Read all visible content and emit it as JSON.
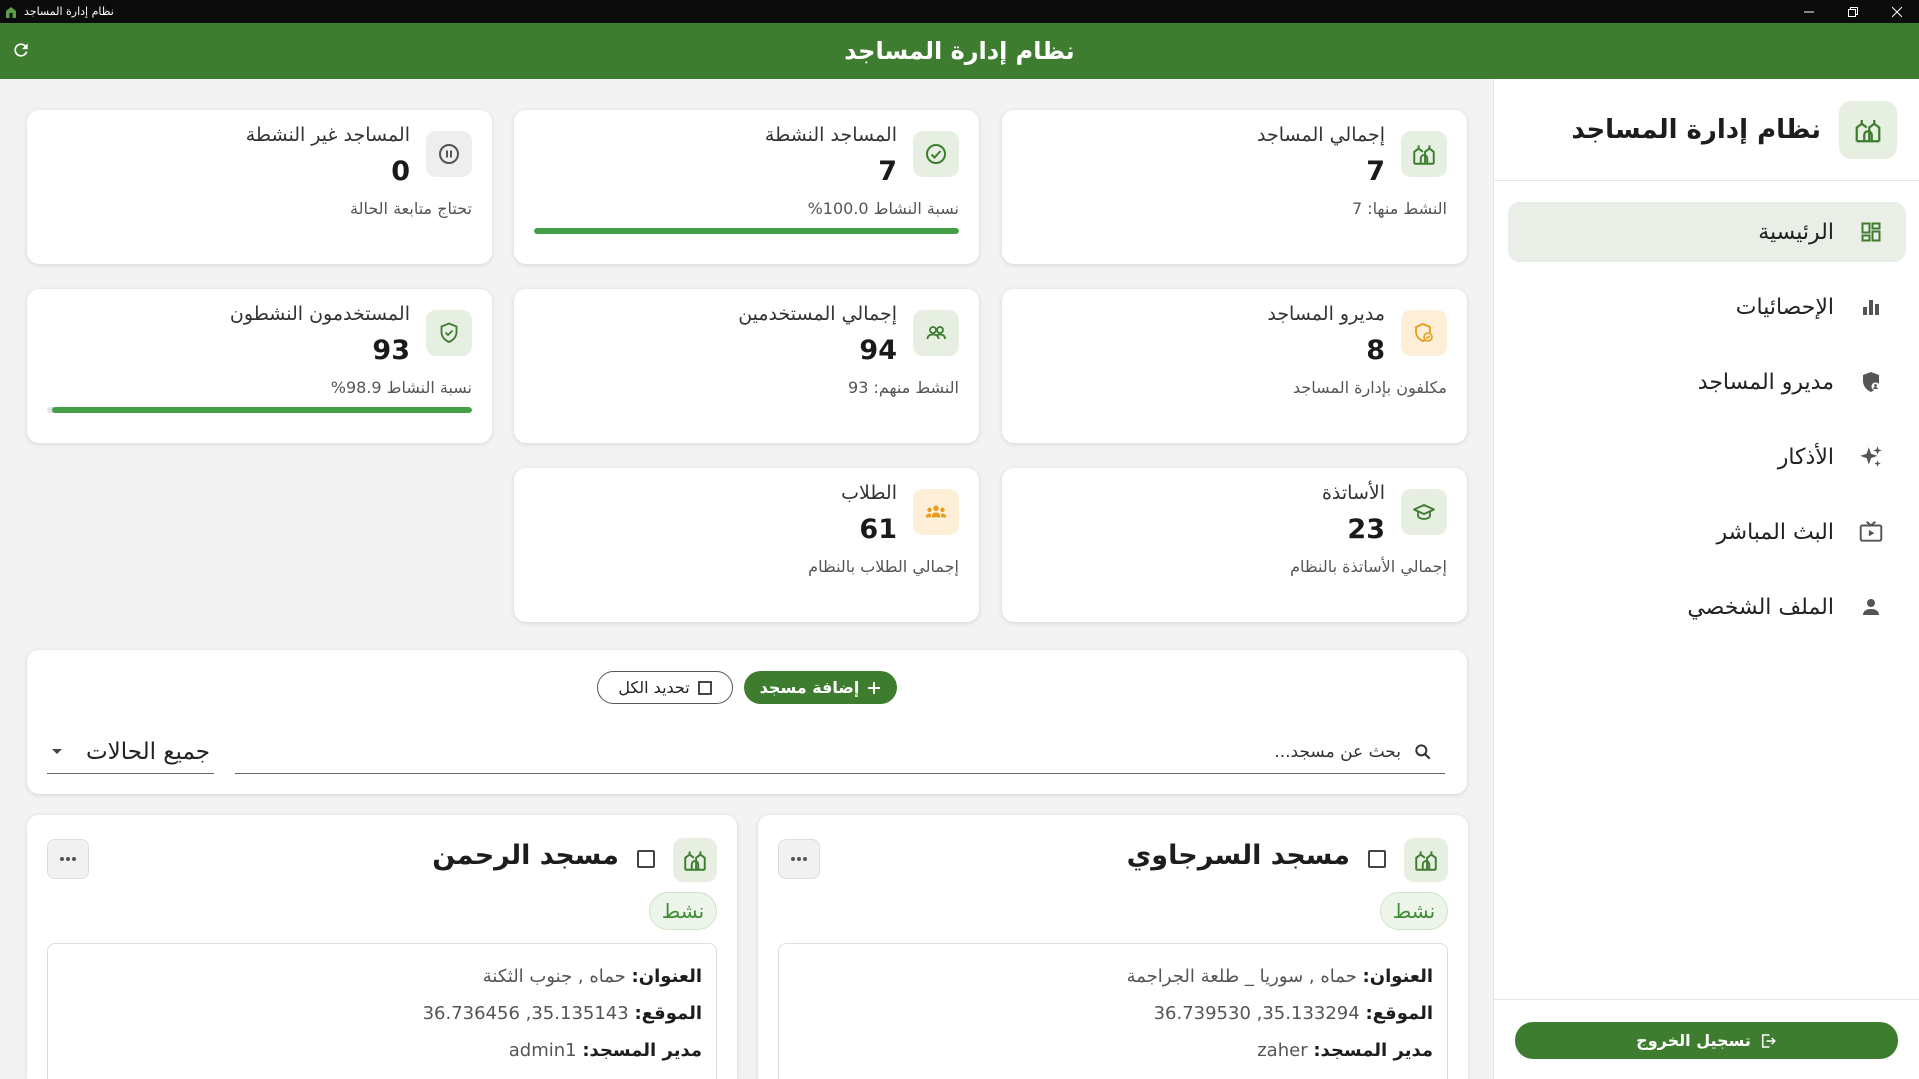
{
  "window": {
    "title": "نظام إدارة المساجد"
  },
  "appbar": {
    "title": "نظام إدارة المساجد"
  },
  "sidebar": {
    "brand": "نظام إدارة المساجد",
    "items": [
      {
        "label": "الرئيسية",
        "icon": "dashboard-icon"
      },
      {
        "label": "الإحصائيات",
        "icon": "bar-chart-icon"
      },
      {
        "label": "مديرو المساجد",
        "icon": "shield-user-icon"
      },
      {
        "label": "الأذكار",
        "icon": "sparkle-icon"
      },
      {
        "label": "البث المباشر",
        "icon": "live-tv-icon"
      },
      {
        "label": "الملف الشخصي",
        "icon": "person-icon"
      }
    ],
    "logout_label": "تسجيل الخروج"
  },
  "stats": {
    "total_mosques": {
      "title": "إجمالي المساجد",
      "value": "7",
      "sub": "النشط منها: 7"
    },
    "active_mosques": {
      "title": "المساجد النشطة",
      "value": "7",
      "sub": "نسبة النشاط 100.0%",
      "progress": 1.0
    },
    "inactive_mosques": {
      "title": "المساجد غير النشطة",
      "value": "0",
      "sub": "تحتاج متابعة الحالة"
    },
    "mosque_managers": {
      "title": "مديرو المساجد",
      "value": "8",
      "sub": "مكلفون بإدارة المساجد"
    },
    "total_users": {
      "title": "إجمالي المستخدمين",
      "value": "94",
      "sub": "النشط منهم: 93"
    },
    "active_users": {
      "title": "المستخدمون النشطون",
      "value": "93",
      "sub": "نسبة النشاط 98.9%",
      "progress": 0.989
    },
    "teachers": {
      "title": "الأساتذة",
      "value": "23",
      "sub": "إجمالي الأساتذة بالنظام"
    },
    "students": {
      "title": "الطلاب",
      "value": "61",
      "sub": "إجمالي الطلاب بالنظام"
    }
  },
  "toolbar": {
    "add_label": "إضافة مسجد",
    "select_all_label": "تحديد الكل",
    "search_placeholder": "بحث عن مسجد...",
    "status_filter": "جميع الحالات"
  },
  "mosques": [
    {
      "name": "مسجد السرجاوي",
      "status": "نشط",
      "address_label": "العنوان:",
      "address": "حماه , سوريا _ طلعة الجراجمة",
      "location_label": "الموقع:",
      "location": "35.133294, 36.739530",
      "manager_label": "مدير المسجد:",
      "manager": "zaher"
    },
    {
      "name": "مسجد الرحمن",
      "status": "نشط",
      "address_label": "العنوان:",
      "address": "حماه , جنوب الثكنة",
      "location_label": "الموقع:",
      "location": "35.135143, 36.736456",
      "manager_label": "مدير المسجد:",
      "manager": "admin1"
    }
  ],
  "colors": {
    "primary": "#3e7d2f",
    "accent_green": "#43a047",
    "icon_bg_green": "#e6efe2",
    "icon_bg_orange": "#fdefd7",
    "icon_orange": "#e89b1c"
  }
}
